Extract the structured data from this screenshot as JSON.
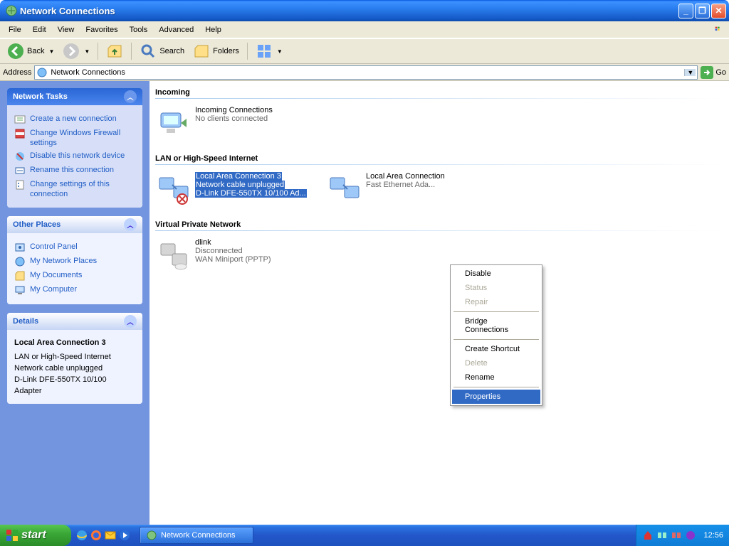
{
  "titlebar": {
    "title": "Network Connections"
  },
  "menubar": {
    "file": "File",
    "edit": "Edit",
    "view": "View",
    "favorites": "Favorites",
    "tools": "Tools",
    "advanced": "Advanced",
    "help": "Help"
  },
  "toolbar": {
    "back": "Back",
    "search": "Search",
    "folders": "Folders"
  },
  "addressbar": {
    "label": "Address",
    "value": "Network Connections",
    "go": "Go"
  },
  "sidebar": {
    "tasks_title": "Network Tasks",
    "tasks": [
      {
        "label": "Create a new connection"
      },
      {
        "label": "Change Windows Firewall settings"
      },
      {
        "label": "Disable this network device"
      },
      {
        "label": "Rename this connection"
      },
      {
        "label": "Change settings of this connection"
      }
    ],
    "places_title": "Other Places",
    "places": [
      {
        "label": "Control Panel"
      },
      {
        "label": "My Network Places"
      },
      {
        "label": "My Documents"
      },
      {
        "label": "My Computer"
      }
    ],
    "details_title": "Details",
    "details": {
      "name": "Local Area Connection 3",
      "type": "LAN or High-Speed Internet",
      "status": "Network cable unplugged",
      "device": "D-Link DFE-550TX 10/100 Adapter"
    }
  },
  "groups": {
    "incoming": {
      "header": "Incoming",
      "items": [
        {
          "title": "Incoming Connections",
          "sub1": "No clients connected",
          "sub2": ""
        }
      ]
    },
    "lan": {
      "header": "LAN or High-Speed Internet",
      "items": [
        {
          "title": "Local Area Connection 3",
          "sub1": "Network cable unplugged",
          "sub2": "D-Link DFE-550TX 10/100 Ad..."
        },
        {
          "title": "Local Area Connection",
          "sub1": "",
          "sub2": "Fast Ethernet Ada..."
        }
      ]
    },
    "vpn": {
      "header": "Virtual Private Network",
      "items": [
        {
          "title": "dlink",
          "sub1": "Disconnected",
          "sub2": "WAN Miniport (PPTP)"
        }
      ]
    }
  },
  "contextmenu": {
    "disable": "Disable",
    "status": "Status",
    "repair": "Repair",
    "bridge": "Bridge Connections",
    "shortcut": "Create Shortcut",
    "delete": "Delete",
    "rename": "Rename",
    "properties": "Properties"
  },
  "taskbar": {
    "start": "start",
    "task": "Network Connections",
    "clock": "12:56"
  }
}
